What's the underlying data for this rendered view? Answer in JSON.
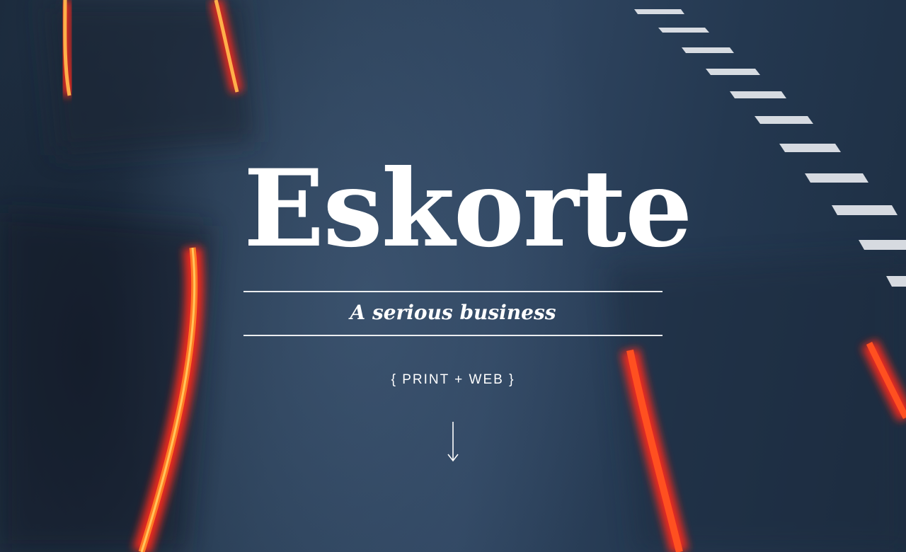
{
  "hero": {
    "title": "Eskorte",
    "tagline": "A serious business",
    "services": "{ PRINT + WEB }"
  },
  "icons": {
    "scroll": "arrow-down-icon"
  },
  "colors": {
    "background": "#2b4058",
    "text": "#ffffff",
    "taillight": "#ff2a1a",
    "lane_marking": "#e6e9ee"
  }
}
